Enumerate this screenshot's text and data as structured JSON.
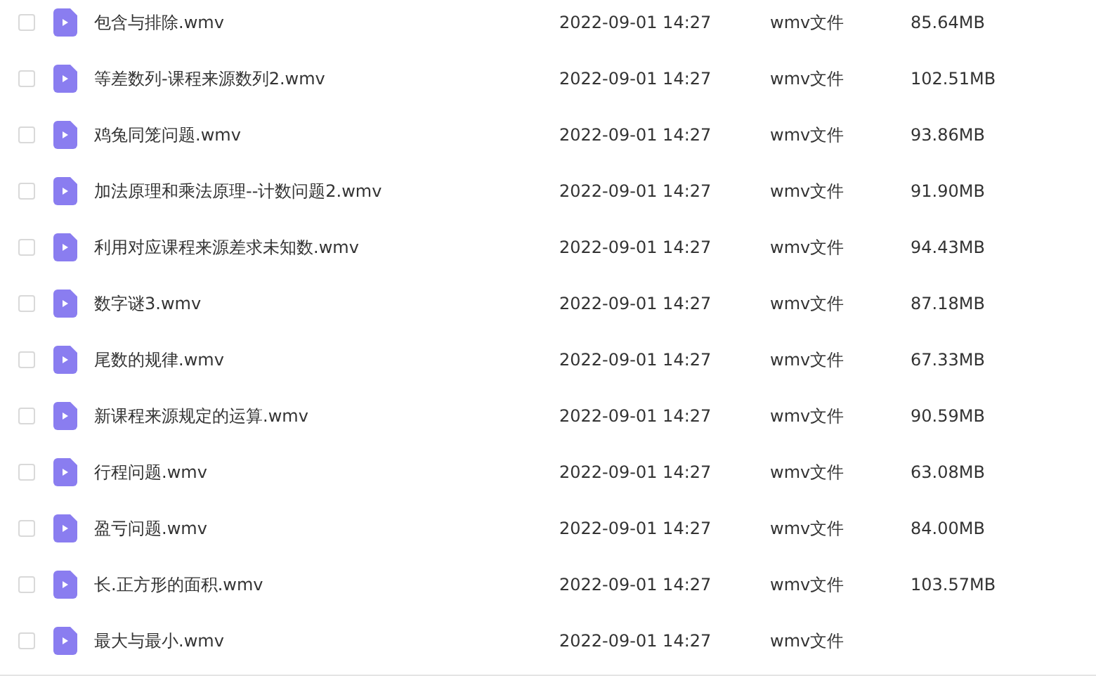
{
  "files": [
    {
      "name": "包含与排除.wmv",
      "date": "2022-09-01 14:27",
      "type": "wmv文件",
      "size": "85.64MB",
      "checked": false
    },
    {
      "name": "等差数列-课程来源数列2.wmv",
      "date": "2022-09-01 14:27",
      "type": "wmv文件",
      "size": "102.51MB",
      "checked": false
    },
    {
      "name": "鸡兔同笼问题.wmv",
      "date": "2022-09-01 14:27",
      "type": "wmv文件",
      "size": "93.86MB",
      "checked": false
    },
    {
      "name": "加法原理和乘法原理--计数问题2.wmv",
      "date": "2022-09-01 14:27",
      "type": "wmv文件",
      "size": "91.90MB",
      "checked": false
    },
    {
      "name": "利用对应课程来源差求未知数.wmv",
      "date": "2022-09-01 14:27",
      "type": "wmv文件",
      "size": "94.43MB",
      "checked": false
    },
    {
      "name": "数字谜3.wmv",
      "date": "2022-09-01 14:27",
      "type": "wmv文件",
      "size": "87.18MB",
      "checked": false
    },
    {
      "name": "尾数的规律.wmv",
      "date": "2022-09-01 14:27",
      "type": "wmv文件",
      "size": "67.33MB",
      "checked": false
    },
    {
      "name": "新课程来源规定的运算.wmv",
      "date": "2022-09-01 14:27",
      "type": "wmv文件",
      "size": "90.59MB",
      "checked": false
    },
    {
      "name": "行程问题.wmv",
      "date": "2022-09-01 14:27",
      "type": "wmv文件",
      "size": "63.08MB",
      "checked": false
    },
    {
      "name": "盈亏问题.wmv",
      "date": "2022-09-01 14:27",
      "type": "wmv文件",
      "size": "84.00MB",
      "checked": false
    },
    {
      "name": "长.正方形的面积.wmv",
      "date": "2022-09-01 14:27",
      "type": "wmv文件",
      "size": "103.57MB",
      "checked": false
    },
    {
      "name": "最大与最小.wmv",
      "date": "2022-09-01 14:27",
      "type": "wmv文件",
      "checked": false
    }
  ]
}
